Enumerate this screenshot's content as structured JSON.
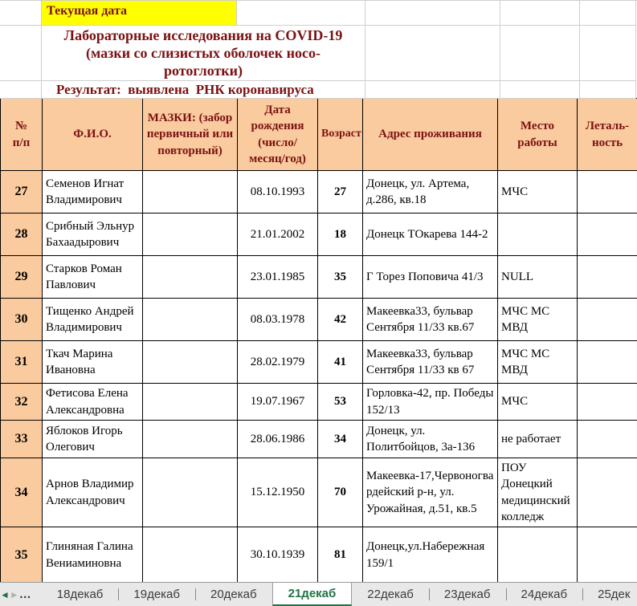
{
  "top": {
    "current_date_label": "Текущая дата",
    "title": "Лабораторные исследования на COVID-19\n(мазки со слизистых оболочек носо-\nротоглотки)",
    "result_line": "Результат:  выявлена  РНК коронавируса"
  },
  "table": {
    "headers": [
      "№\nп/п",
      "Ф.И.О.",
      "МАЗКИ: (забор первичный или повторный)",
      "Дата рождения (число/ месяц/год)",
      "Возраст",
      "Адрес проживания",
      "Место работы",
      "Леталь-\nность"
    ],
    "rows": [
      [
        "27",
        "Семенов Игнат Владимирович",
        "",
        "08.10.1993",
        "27",
        "Донецк, ул. Артема, д.286, кв.18",
        "МЧС",
        ""
      ],
      [
        "28",
        "Срибный Эльнур Бахаадырович",
        "",
        "21.01.2002",
        "18",
        "Донецк ТОкарева 144-2",
        "",
        ""
      ],
      [
        "29",
        "Старков Роман Павлович",
        "",
        "23.01.1985",
        "35",
        "Г Торез Поповича 41/3",
        "NULL",
        ""
      ],
      [
        "30",
        "Тищенко Андрей Владимирович",
        "",
        "08.03.1978",
        "42",
        "Макеевка33, бульвар Сентября 11/33 кв.67",
        "МЧС МС МВД",
        ""
      ],
      [
        "31",
        "Ткач Марина Ивановна",
        "",
        "28.02.1979",
        "41",
        "Макеевка33, бульвар Сентября 11/33 кв 67",
        "МЧС МС МВД",
        ""
      ],
      [
        "32",
        "Фетисова Елена Александровна",
        "",
        "19.07.1967",
        "53",
        "Горловка-42, пр. Победы 152/13",
        "МЧС",
        ""
      ],
      [
        "33",
        "Яблоков Игорь Олегович",
        "",
        "28.06.1986",
        "34",
        "Донецк, ул. Политбойцов, 3а-136",
        "не работает",
        ""
      ],
      [
        "34",
        "Арнов Владимир Александрович",
        "",
        "15.12.1950",
        "70",
        "Макеевка-17,Червоногвардейский р-н, ул. Урожайная, д.51, кв.5",
        "ПОУ Донецкий медицинский колледж",
        ""
      ],
      [
        "35",
        "Глиняная Галина Вениаминовна",
        "",
        "30.10.1939",
        "81",
        "Донецк,ул.Набережная 159/1",
        "",
        ""
      ]
    ]
  },
  "tabs": {
    "overflow_indicator": "…",
    "items": [
      "18декаб",
      "19декаб",
      "20декаб",
      "21декаб",
      "22декаб",
      "23декаб",
      "24декаб",
      "25дек"
    ],
    "active": "21декаб"
  },
  "icons": {
    "prev_sheet": "◄",
    "next_sheet": "►"
  },
  "colors": {
    "header_bg": "#FACB9E",
    "dark_red_text": "#7B1113",
    "highlight_yellow": "#FFFF00",
    "active_tab_green": "#1F7245",
    "gridline_gray": "#CFCFCF"
  }
}
